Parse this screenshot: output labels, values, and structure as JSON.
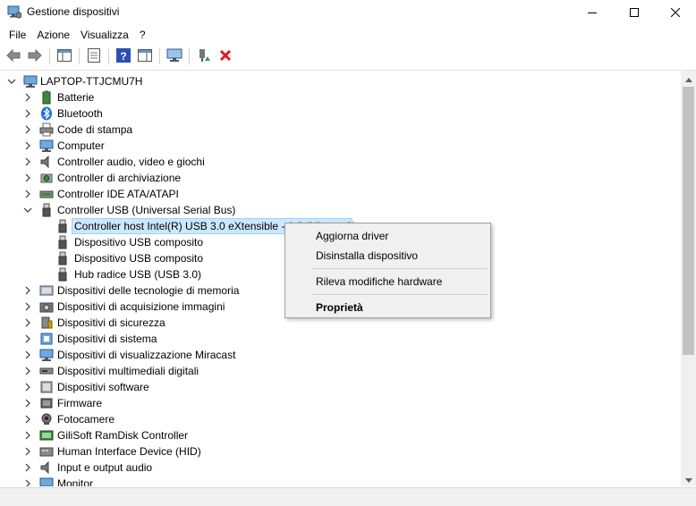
{
  "window": {
    "title": "Gestione dispositivi",
    "controls": [
      "minimize-icon",
      "maximize-icon",
      "close-icon"
    ]
  },
  "menu": [
    "File",
    "Azione",
    "Visualizza",
    "?"
  ],
  "toolbar": {
    "buttons": [
      "back-arrow-icon",
      "forward-arrow-icon",
      "console-tree-icon",
      "properties-icon",
      "help-icon",
      "action-pane-icon",
      "scan-monitor-icon",
      "update-driver-icon",
      "uninstall-x-icon"
    ]
  },
  "tree": {
    "root": "LAPTOP-TTJCMU7H",
    "categories": [
      {
        "label": "Batterie",
        "icon": "battery-icon"
      },
      {
        "label": "Bluetooth",
        "icon": "bluetooth-icon"
      },
      {
        "label": "Code di stampa",
        "icon": "printer-icon"
      },
      {
        "label": "Computer",
        "icon": "monitor-icon"
      },
      {
        "label": "Controller audio, video e giochi",
        "icon": "speaker-icon"
      },
      {
        "label": "Controller di archiviazione",
        "icon": "storage-icon"
      },
      {
        "label": "Controller IDE ATA/ATAPI",
        "icon": "ide-icon"
      },
      {
        "label": "Controller USB (Universal Serial Bus)",
        "icon": "usb-icon",
        "expanded": true,
        "children": [
          {
            "label": "Controller host Intel(R) USB 3.0 eXtensible - 1.0 (Microsoft)",
            "icon": "usb-icon",
            "selected": true
          },
          {
            "label": "Dispositivo USB composito",
            "icon": "usb-icon"
          },
          {
            "label": "Dispositivo USB composito",
            "icon": "usb-icon"
          },
          {
            "label": "Hub radice USB (USB 3.0)",
            "icon": "usb-icon"
          }
        ]
      },
      {
        "label": "Dispositivi delle tecnologie di memoria",
        "icon": "memory-icon"
      },
      {
        "label": "Dispositivi di acquisizione immagini",
        "icon": "camera-icon"
      },
      {
        "label": "Dispositivi di sicurezza",
        "icon": "security-icon"
      },
      {
        "label": "Dispositivi di sistema",
        "icon": "system-icon"
      },
      {
        "label": "Dispositivi di visualizzazione Miracast",
        "icon": "miracast-icon"
      },
      {
        "label": "Dispositivi multimediali digitali",
        "icon": "media-icon"
      },
      {
        "label": "Dispositivi software",
        "icon": "software-icon"
      },
      {
        "label": "Firmware",
        "icon": "firmware-icon"
      },
      {
        "label": "Fotocamere",
        "icon": "webcam-icon"
      },
      {
        "label": "GiliSoft RamDisk Controller",
        "icon": "ramdisk-icon"
      },
      {
        "label": "Human Interface Device (HID)",
        "icon": "hid-icon"
      },
      {
        "label": "Input e output audio",
        "icon": "audio-io-icon"
      },
      {
        "label": "Monitor",
        "icon": "monitor-icon"
      }
    ]
  },
  "context_menu": {
    "items": [
      "Aggiorna driver",
      "Disinstalla dispositivo",
      "Rileva modifiche hardware",
      "Proprietà"
    ]
  },
  "colors": {
    "selection_bg": "#cce8ff",
    "selection_border": "#99d1ff",
    "menu_bg": "#f0f0f0",
    "accent_blue": "#1e73c8",
    "uninstall_red": "#d81e1e"
  }
}
